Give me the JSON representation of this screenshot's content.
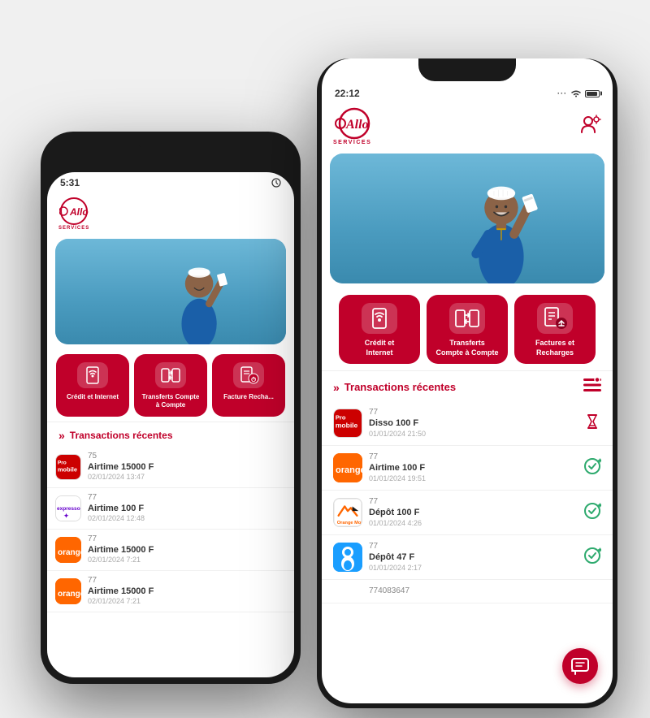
{
  "app": {
    "name": "Allo Services",
    "logo_text": "Allo",
    "logo_subtitle": "SERVICES"
  },
  "phone_back": {
    "status_time": "5:31",
    "services": [
      {
        "id": "credit-internet",
        "label": "Crédit et\nInternet"
      },
      {
        "id": "transferts",
        "label": "Transferts\nCompte à Compte"
      },
      {
        "id": "factures",
        "label": "Facture\nRecha..."
      }
    ],
    "transactions_title": "Transactions récentes",
    "transactions": [
      {
        "operator": "promobile",
        "number": "75",
        "amount": "Airtime 15000 F",
        "date": "02/01/2024 13:47"
      },
      {
        "operator": "expresso",
        "number": "77",
        "amount": "Airtime 100 F",
        "date": "02/01/2024 12:48"
      },
      {
        "operator": "orange",
        "number": "77",
        "amount": "Airtime 15000 F",
        "date": "02/01/2024 7:21"
      },
      {
        "operator": "orange",
        "number": "77",
        "amount": "Airtime 15000 F",
        "date": "02/01/2024 7:21"
      }
    ]
  },
  "phone_front": {
    "status_time": "22:12",
    "services": [
      {
        "id": "credit-internet",
        "label": "Crédit et\nInternet"
      },
      {
        "id": "transferts",
        "label": "Transferts\nCompte à Compte"
      },
      {
        "id": "factures",
        "label": "Factures et\nRecharges"
      }
    ],
    "transactions_title": "Transactions récentes",
    "transactions": [
      {
        "operator": "promobile",
        "number": "77",
        "amount": "Disso 100 F",
        "date": "01/01/2024 21:50",
        "status": "pending"
      },
      {
        "operator": "orange",
        "number": "77",
        "amount": "Airtime 100 F",
        "date": "01/01/2024 19:51",
        "status": "success"
      },
      {
        "operator": "orange-money",
        "number": "77",
        "amount": "Dépôt 100 F",
        "date": "01/01/2024 4:26",
        "status": "success"
      },
      {
        "operator": "wave",
        "number": "77",
        "amount": "Dépôt 47 F",
        "date": "01/01/2024 2:17",
        "status": "success"
      },
      {
        "operator": "unknown",
        "number": "774083647",
        "amount": "",
        "date": "",
        "status": ""
      }
    ],
    "fab_icon": "💬"
  },
  "colors": {
    "primary": "#c0002a",
    "text_dark": "#333333",
    "text_muted": "#888888",
    "bg_white": "#ffffff",
    "border_light": "#f0f0f0"
  }
}
